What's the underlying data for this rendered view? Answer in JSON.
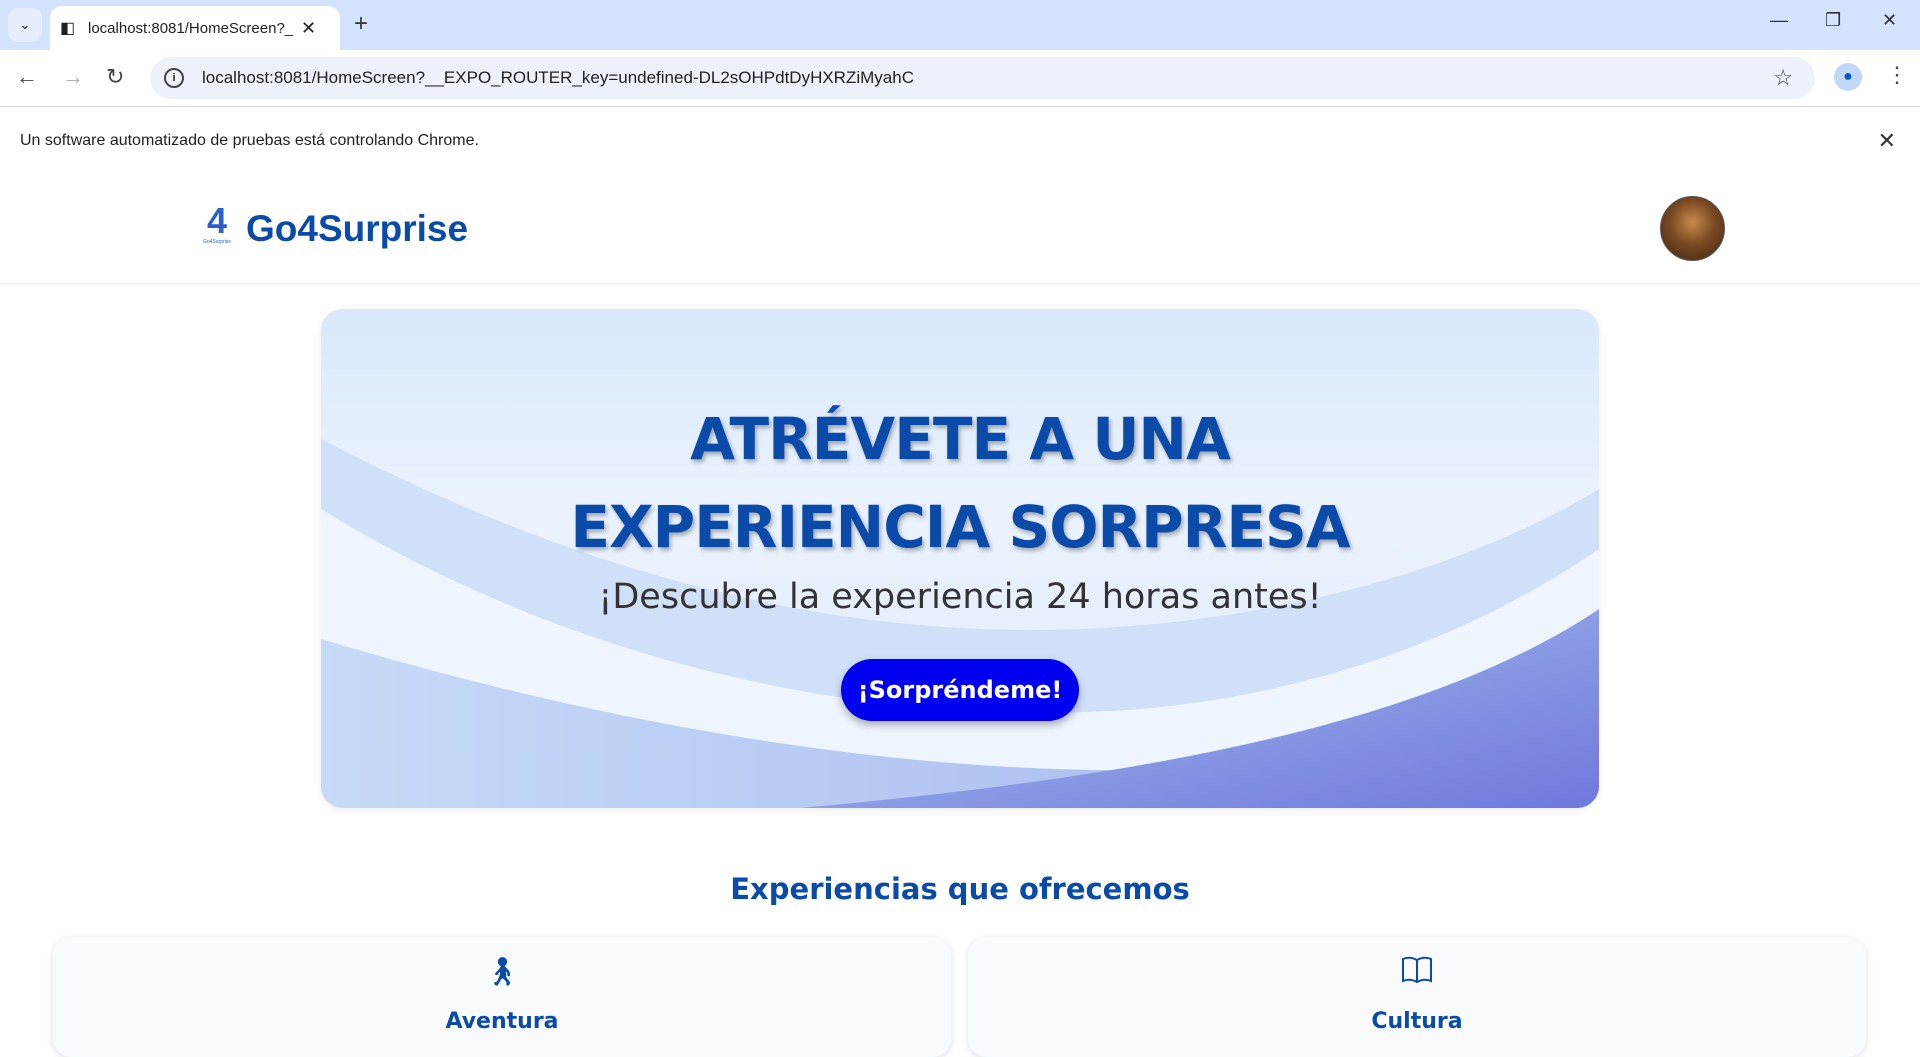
{
  "browser": {
    "tab_title": "localhost:8081/HomeScreen?__EXPO_ROUTER_key=undefined-DL2sOHPdtDyHXRZiMyahC",
    "url": "localhost:8081/HomeScreen?__EXPO_ROUTER_key=undefined-DL2sOHPdtDyHXRZiMyahC",
    "infobar": "Un software automatizado de pruebas está controlando Chrome."
  },
  "header": {
    "brand": "Go4Surprise",
    "logo_text": "4",
    "logo_small": "GO",
    "logo_caption": "Go4Surprise"
  },
  "hero": {
    "title_line1": "ATRÉVETE A UNA",
    "title_line2": "EXPERIENCIA SORPRESA",
    "subtitle": "¡Descubre la experiencia 24 horas antes!",
    "cta": "¡Sorpréndeme!"
  },
  "section": {
    "title": "Experiencias que ofrecemos",
    "cards": [
      {
        "label": "Aventura",
        "icon": "walking-person-icon"
      },
      {
        "label": "Cultura",
        "icon": "book-icon"
      }
    ]
  },
  "colors": {
    "brand": "#0a4aa8",
    "cta": "#0000f0"
  }
}
